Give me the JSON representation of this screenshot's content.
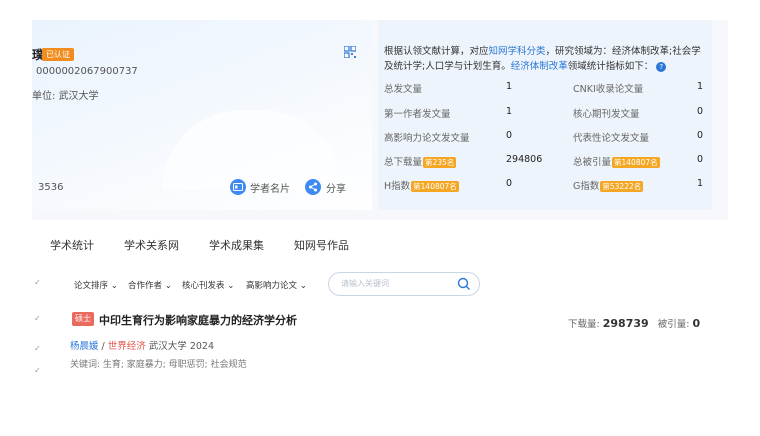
{
  "profile": {
    "badge": "已认证",
    "title_fragment": "璞",
    "scholar_id": "0000002067900737",
    "unit_label": "单位:",
    "unit_value": "武汉大学",
    "left_number": "3536",
    "card_label": "学者名片",
    "share_label": "分享"
  },
  "stats": {
    "desc_pre": "根据认领文献计算，对应",
    "desc_link1": "知网学科分类",
    "desc_mid": "，研究领域为：经济体制改革;社会学及统计学;人口学与计划生育。",
    "desc_link2": "经济体制改革",
    "desc_post": "领域统计指标如下：",
    "help": "?",
    "rows": [
      {
        "l1": "总发文量",
        "r1": "",
        "v1": "1",
        "l2": "CNKI收录论文量",
        "r2": "",
        "v2": "1"
      },
      {
        "l1": "第一作者发文量",
        "r1": "",
        "v1": "1",
        "l2": "核心期刊发文量",
        "r2": "",
        "v2": "0"
      },
      {
        "l1": "高影响力论文发文量",
        "r1": "",
        "v1": "0",
        "l2": "代表性论文发文量",
        "r2": "",
        "v2": "0"
      },
      {
        "l1": "总下载量",
        "r1": "第235名",
        "v1": "294806",
        "l2": "总被引量",
        "r2": "第140807名",
        "v2": "0"
      },
      {
        "l1": "H指数",
        "r1": "第140807名",
        "v1": "0",
        "l2": "G指数",
        "r2": "第53222名",
        "v2": "1"
      }
    ]
  },
  "tabs": [
    "学术统计",
    "学术关系网",
    "学术成果集",
    "知网号作品"
  ],
  "filter": {
    "items": [
      "论文排序",
      "合作作者",
      "核心刊发表",
      "高影响力论文"
    ],
    "search_placeholder": "请输入关键词"
  },
  "result": {
    "tag": "硕士",
    "title": "中印生育行为影响家庭暴力的经济学分析",
    "author": "杨晨媛",
    "sep": " / ",
    "tutor": "世界经济",
    "source": " 武汉大学 2024",
    "keywords": "关键词: 生育; 家庭暴力; 母职惩罚; 社会规范",
    "download_label": "下载量:",
    "download_value": "298739",
    "cite_label": "被引量:",
    "cite_value": "0"
  },
  "icons": [
    "qr-code-icon",
    "card-icon",
    "share-icon",
    "search-icon",
    "chevron-down-icon",
    "help-icon"
  ]
}
